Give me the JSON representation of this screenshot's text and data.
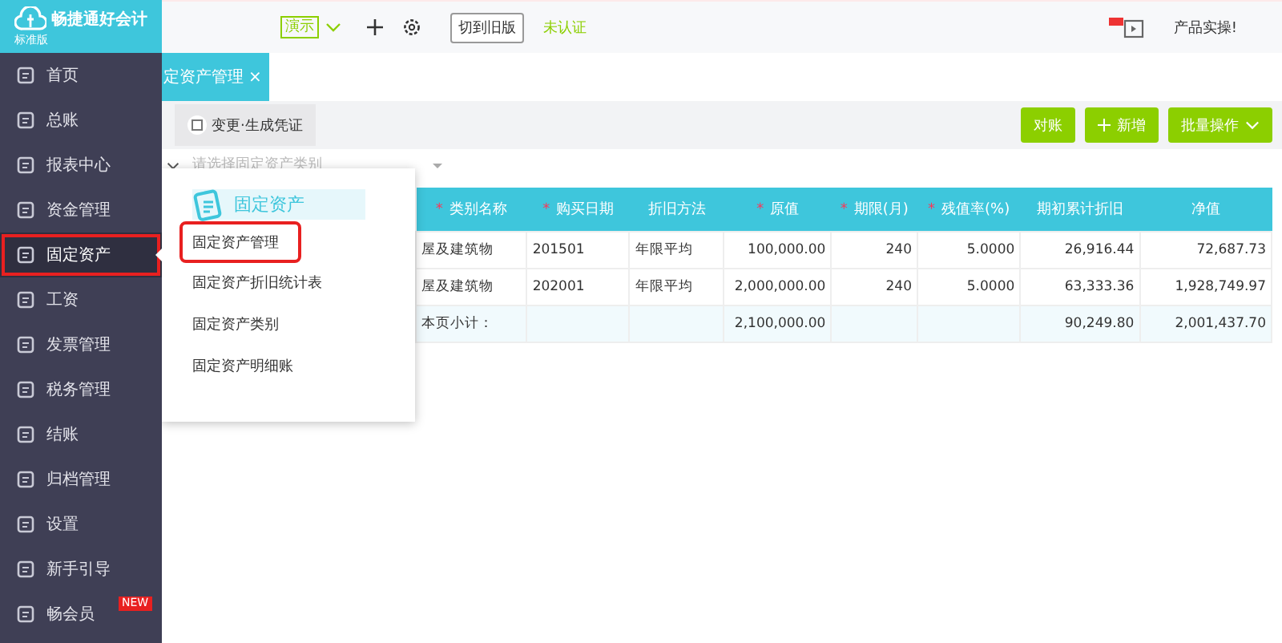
{
  "logo": {
    "name": "畅捷通好会计",
    "edition": "标准版"
  },
  "header": {
    "account": "演示",
    "switch_button": "切到旧版",
    "auth_status": "未认证",
    "promo": "产品实操!"
  },
  "sidebar": {
    "items": [
      {
        "label": "首页",
        "selected": false,
        "annotated": false
      },
      {
        "label": "总账",
        "selected": false,
        "annotated": false
      },
      {
        "label": "报表中心",
        "selected": false,
        "annotated": false
      },
      {
        "label": "资金管理",
        "selected": false,
        "annotated": false
      },
      {
        "label": "固定资产",
        "selected": true,
        "annotated": true
      },
      {
        "label": "工资",
        "selected": false,
        "annotated": false
      },
      {
        "label": "发票管理",
        "selected": false,
        "annotated": false
      },
      {
        "label": "税务管理",
        "selected": false,
        "annotated": false
      },
      {
        "label": "结账",
        "selected": false,
        "annotated": false
      },
      {
        "label": "归档管理",
        "selected": false,
        "annotated": false
      },
      {
        "label": "设置",
        "selected": false,
        "annotated": false
      },
      {
        "label": "新手引导",
        "selected": false,
        "annotated": false
      },
      {
        "label": "畅会员",
        "selected": false,
        "annotated": false,
        "badge": "NEW"
      }
    ]
  },
  "tabs": [
    {
      "label": "定资产管理",
      "close": "×",
      "selected": true
    }
  ],
  "toolbar": {
    "left_button": "变更·生成凭证",
    "buttons": [
      {
        "label": "对账",
        "kind": "plain"
      },
      {
        "label": "新增",
        "kind": "add"
      },
      {
        "label": "批量操作",
        "kind": "menu"
      }
    ]
  },
  "filter": {
    "placeholder": "请选择固定资产类别"
  },
  "popup": {
    "title": "固定资产",
    "items": [
      {
        "label": "固定资产管理",
        "annotated": true
      },
      {
        "label": "固定资产折旧统计表",
        "annotated": false
      },
      {
        "label": "固定资产类别",
        "annotated": false
      },
      {
        "label": "固定资产明细账",
        "annotated": false
      }
    ]
  },
  "table": {
    "columns": [
      {
        "label": "类别名称",
        "required_mark": "*"
      },
      {
        "label": "购买日期",
        "required_mark": "*"
      },
      {
        "label": "折旧方法"
      },
      {
        "label": "原值",
        "required_mark": "*"
      },
      {
        "label": "期限(月)",
        "required_mark": "*"
      },
      {
        "label": "残值率(%)",
        "required_mark": "*"
      },
      {
        "label": "期初累计折旧"
      },
      {
        "label": "净值"
      }
    ],
    "rows": [
      [
        "屋及建筑物",
        "201501",
        "年限平均",
        "100,000.00",
        "240",
        "5.0000",
        "26,916.44",
        "72,687.73"
      ],
      [
        "屋及建筑物",
        "202001",
        "年限平均",
        "2,000,000.00",
        "240",
        "5.0000",
        "63,333.36",
        "1,928,749.97"
      ]
    ],
    "subtotal": {
      "label": "本页小计：",
      "cells": [
        "",
        "",
        "",
        "2,100,000.00",
        "",
        "",
        "90,249.80",
        "2,001,437.70"
      ]
    }
  }
}
